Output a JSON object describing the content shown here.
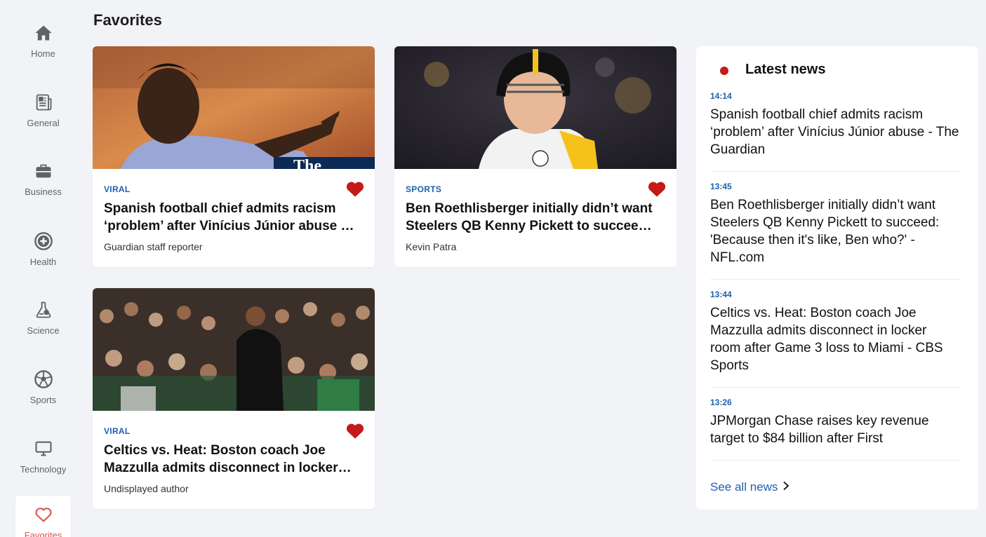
{
  "sidebar": {
    "items": [
      {
        "label": "Home",
        "icon": "home-icon"
      },
      {
        "label": "General",
        "icon": "newspaper-icon"
      },
      {
        "label": "Business",
        "icon": "briefcase-icon"
      },
      {
        "label": "Health",
        "icon": "health-plus-icon"
      },
      {
        "label": "Science",
        "icon": "flask-icon"
      },
      {
        "label": "Sports",
        "icon": "soccer-ball-icon"
      },
      {
        "label": "Technology",
        "icon": "monitor-icon"
      },
      {
        "label": "Favorites",
        "icon": "heart-outline-icon"
      }
    ],
    "active": "Favorites",
    "active_color": "#d9534f"
  },
  "page": {
    "title": "Favorites"
  },
  "cards": [
    {
      "category": "VIRAL",
      "title": "Spanish football chief admits racism ‘problem’ after Vinícius Júnior abuse - The Guardian",
      "author": "Guardian staff reporter",
      "image_text": "The"
    },
    {
      "category": "SPORTS",
      "title": "Ben Roethlisberger initially didn’t want Steelers QB Kenny Pickett to succeed: 'Because then it's like, Ben who?' - NFL.com",
      "author": "Kevin Patra"
    },
    {
      "category": "VIRAL",
      "title": "Celtics vs. Heat: Boston coach Joe Mazzulla admits disconnect in locker room after Game 3 loss to Miami - CBS Sports",
      "author": "Undisplayed author"
    }
  ],
  "latest": {
    "heading": "Latest news",
    "items": [
      {
        "time": "14:14",
        "headline": "Spanish football chief admits racism ‘problem’ after Vinícius Júnior abuse - The Guardian"
      },
      {
        "time": "13:45",
        "headline": "Ben Roethlisberger initially didn’t want Steelers QB Kenny Pickett to succeed: 'Because then it's like, Ben who?' - NFL.com"
      },
      {
        "time": "13:44",
        "headline": "Celtics vs. Heat: Boston coach Joe Mazzulla admits disconnect in locker room after Game 3 loss to Miami - CBS Sports"
      },
      {
        "time": "13:26",
        "headline": "JPMorgan Chase raises key revenue target to $84 billion after First"
      }
    ],
    "see_all": "See all news"
  },
  "colors": {
    "accent": "#1f5fb0",
    "heart": "#c41a1a",
    "background": "#f2f3f7"
  }
}
